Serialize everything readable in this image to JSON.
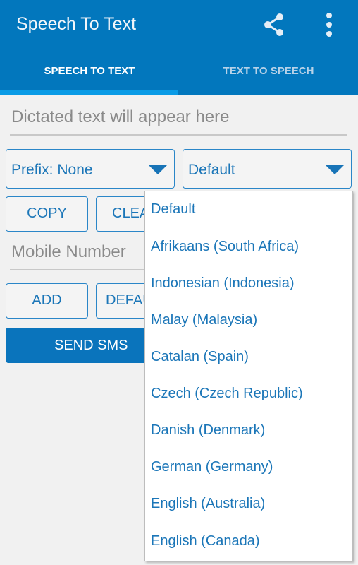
{
  "appbar": {
    "title": "Speech To Text",
    "icons": [
      "share-icon",
      "more-vert-icon"
    ],
    "color": "#0277bd"
  },
  "tabs": [
    {
      "label": "SPEECH TO TEXT",
      "selected": true
    },
    {
      "label": "TEXT TO SPEECH",
      "selected": false
    }
  ],
  "dictation": {
    "placeholder": "Dictated text will appear here",
    "value": ""
  },
  "prefix_spinner": {
    "value": "Prefix: None"
  },
  "language_spinner": {
    "value": "Default",
    "options": [
      "Default",
      "Afrikaans (South Africa)",
      "Indonesian (Indonesia)",
      "Malay (Malaysia)",
      "Catalan (Spain)",
      "Czech (Czech Republic)",
      "Danish (Denmark)",
      "German (Germany)",
      "English (Australia)",
      "English (Canada)"
    ]
  },
  "buttons": {
    "copy": "COPY",
    "clear": "CLEAR",
    "add": "ADD",
    "default": "DEFAULT",
    "send_sms": "SEND SMS"
  },
  "mobile": {
    "placeholder": "Mobile Number",
    "value": ""
  }
}
